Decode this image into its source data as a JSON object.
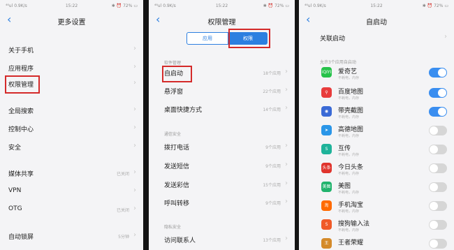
{
  "status": {
    "left": "⁴⁶ul  0.9K/s",
    "time": "15:22",
    "right": "✱ ⏰ 72% ▭"
  },
  "screen1": {
    "title": "更多设置",
    "items": [
      {
        "label": "关于手机",
        "value": ""
      },
      {
        "label": "应用程序",
        "value": ""
      },
      {
        "label": "权限管理",
        "value": ""
      },
      {
        "label": "全局搜索",
        "value": ""
      },
      {
        "label": "控制中心",
        "value": ""
      },
      {
        "label": "安全",
        "value": ""
      },
      {
        "label": "媒体共享",
        "value": "已关闭"
      },
      {
        "label": "VPN",
        "value": ""
      },
      {
        "label": "OTG",
        "value": "已关闭"
      },
      {
        "label": "自动锁屏",
        "value": "5分钟"
      }
    ]
  },
  "screen2": {
    "title": "权限管理",
    "tabs": [
      "应用",
      "权限"
    ],
    "section1": "软件管理",
    "items1": [
      {
        "label": "自启动",
        "value": "18个应用"
      },
      {
        "label": "悬浮窗",
        "value": "22个应用"
      },
      {
        "label": "桌面快捷方式",
        "value": "14个应用"
      }
    ],
    "section2": "通信安全",
    "items2": [
      {
        "label": "拨打电话",
        "value": "9个应用"
      },
      {
        "label": "发送短信",
        "value": "9个应用"
      },
      {
        "label": "发送彩信",
        "value": "15个应用"
      },
      {
        "label": "呼叫转移",
        "value": "9个应用"
      }
    ],
    "section3": "隐私安全",
    "items3": [
      {
        "label": "访问联系人",
        "value": "13个应用"
      }
    ]
  },
  "screen3": {
    "title": "自启动",
    "assoc": "关联启动",
    "section": "允许3个应用自启动",
    "apps": [
      {
        "name": "爱奇艺",
        "sub": "不耗电，内存",
        "icon": "iqiyi-icon",
        "color": "#26c24a",
        "glyph": "iQIYI",
        "on": true
      },
      {
        "name": "百度地图",
        "sub": "不耗电，内存",
        "icon": "baidu-map-icon",
        "color": "#e83c3c",
        "glyph": "⚲",
        "on": true
      },
      {
        "name": "带壳截图",
        "sub": "不耗电，内存",
        "icon": "screenshot-icon",
        "color": "#3a6ad6",
        "glyph": "◉",
        "on": true
      },
      {
        "name": "高德地图",
        "sub": "不耗电，内存",
        "icon": "amap-icon",
        "color": "#2a96e8",
        "glyph": "➤",
        "on": false
      },
      {
        "name": "互传",
        "sub": "不耗电，内存",
        "icon": "transfer-icon",
        "color": "#1fb39a",
        "glyph": "S",
        "on": false
      },
      {
        "name": "今日头条",
        "sub": "不耗电，内存",
        "icon": "toutiao-icon",
        "color": "#e0342d",
        "glyph": "头条",
        "on": false
      },
      {
        "name": "美图",
        "sub": "不耗电，内存",
        "icon": "meitu-icon",
        "color": "#21b36d",
        "glyph": "美图",
        "on": false
      },
      {
        "name": "手机淘宝",
        "sub": "不耗电，内存",
        "icon": "taobao-icon",
        "color": "#ff6a00",
        "glyph": "淘",
        "on": false
      },
      {
        "name": "搜狗输入法",
        "sub": "不耗电，内存",
        "icon": "sogou-icon",
        "color": "#f05a28",
        "glyph": "S",
        "on": false
      },
      {
        "name": "王者荣耀",
        "sub": "",
        "icon": "honor-of-kings-icon",
        "color": "#d48a2a",
        "glyph": "王",
        "on": false
      }
    ]
  }
}
